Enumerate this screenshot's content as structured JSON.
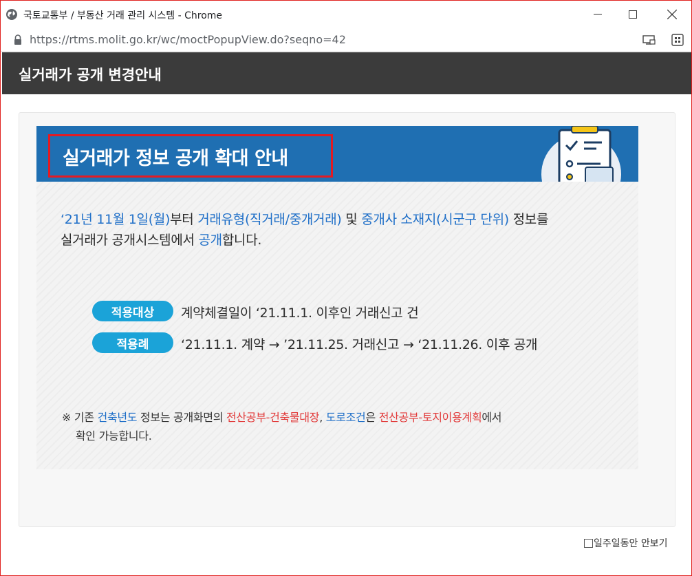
{
  "window": {
    "title": "국토교통부 / 부동산 거래 관리 시스템 - Chrome",
    "url": "https://rtms.molit.go.kr/wc/moctPopupView.do?seqno=42"
  },
  "header": {
    "title": "실거래가 공개 변경안내"
  },
  "banner": {
    "title": "실거래가 정보 공개 확대 안내"
  },
  "notice": {
    "line1": [
      {
        "text": "‘21년 11월 1일(월)",
        "style": "blue"
      },
      {
        "text": "부터 ",
        "style": "normal"
      },
      {
        "text": "거래유형(직거래/중개거래)",
        "style": "blue"
      },
      {
        "text": " 및 ",
        "style": "normal"
      },
      {
        "text": "중개사 소재지(시군구 단위)",
        "style": "blue"
      },
      {
        "text": " 정보를",
        "style": "normal"
      }
    ],
    "line2": [
      {
        "text": "실거래가 공개시스템에서 ",
        "style": "normal"
      },
      {
        "text": "공개",
        "style": "blue"
      },
      {
        "text": "합니다.",
        "style": "normal"
      }
    ]
  },
  "rows": [
    {
      "tag": "적용대상",
      "text": "계약체결일이 ‘21.11.1. 이후인 거래신고 건"
    },
    {
      "tag": "적용례",
      "text": "‘21.11.1. 계약 → ’21.11.25. 거래신고 → ‘21.11.26. 이후 공개"
    }
  ],
  "footnote": {
    "line1": [
      {
        "text": "※ 기존 ",
        "style": "normal"
      },
      {
        "text": "건축년도",
        "style": "blue"
      },
      {
        "text": " 정보는 공개화면의 ",
        "style": "normal"
      },
      {
        "text": "전산공부-건축물대장",
        "style": "red"
      },
      {
        "text": ", ",
        "style": "normal"
      },
      {
        "text": "도로조건",
        "style": "blue"
      },
      {
        "text": "은 ",
        "style": "normal"
      },
      {
        "text": "전산공부-토지이용계획",
        "style": "red"
      },
      {
        "text": "에서",
        "style": "normal"
      }
    ],
    "line2": "확인 가능합니다."
  },
  "footer": {
    "dismiss_label": "일주일동안 안보기"
  },
  "colors": {
    "header_bg": "#3b3b3b",
    "banner_bg": "#1f6fb2",
    "accent_blue": "#1f6fc8",
    "accent_red": "#e23b3b",
    "pill_bg": "#1ba3d8"
  },
  "icons": {
    "site": "globe-icon",
    "secure": "lock-icon",
    "cast": "cast-icon",
    "extension": "extension-icon"
  }
}
